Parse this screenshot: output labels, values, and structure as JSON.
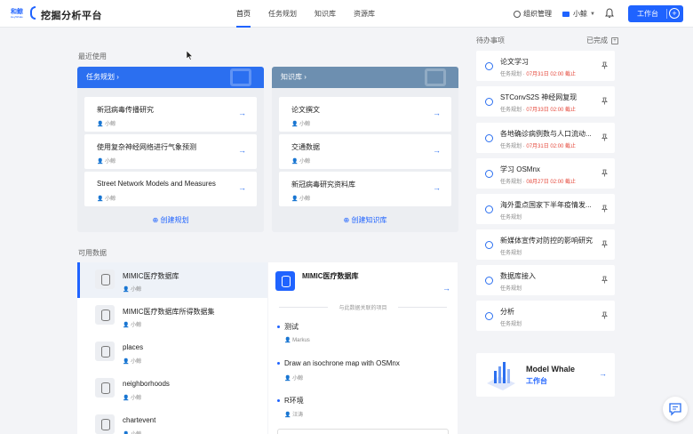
{
  "header": {
    "logo_cn": "和鲸",
    "logo_en": "HeyWhale",
    "app_title": "挖掘分析平台",
    "nav": [
      "首页",
      "任务规划",
      "知识库",
      "资源库"
    ],
    "active_nav": "首页",
    "org": "组织管理",
    "user": "小鲸",
    "workbench": "工作台"
  },
  "recent": {
    "title": "最近使用",
    "planning": {
      "label": "任务规划",
      "items": [
        {
          "title": "新冠病毒传播研究",
          "user": "小鲸"
        },
        {
          "title": "使用复杂神经网络进行气象预测",
          "user": "小鲸"
        },
        {
          "title": "Street Network Models and Measures",
          "user": "小鲸"
        }
      ],
      "create": "创建规划"
    },
    "knowledge": {
      "label": "知识库",
      "items": [
        {
          "title": "论文撰文",
          "user": "小鲸"
        },
        {
          "title": "交通数据",
          "user": "小鲸"
        },
        {
          "title": "新冠病毒研究资料库",
          "user": "小鲸"
        }
      ],
      "create": "创建知识库"
    }
  },
  "data": {
    "title": "可用数据",
    "items": [
      {
        "name": "MIMIC医疗数据库",
        "user": "小鲸"
      },
      {
        "name": "MIMIC医疗数据库所得数据集",
        "user": "小鲸"
      },
      {
        "name": "places",
        "user": "小鲸"
      },
      {
        "name": "neighborhoods",
        "user": "小鲸"
      },
      {
        "name": "chartevent",
        "user": "小鲸"
      }
    ],
    "detail": {
      "name": "MIMIC医疗数据库",
      "related_label": "与此数据关联的项目",
      "projects": [
        {
          "title": "测试",
          "user": "Markus"
        },
        {
          "title": "Draw an isochrone map with OSMnx",
          "user": "小鲸"
        },
        {
          "title": "R环境",
          "user": "汪涛"
        }
      ]
    }
  },
  "todo": {
    "title": "待办事项",
    "done_label": "已完成",
    "items": [
      {
        "name": "论文学习",
        "type": "任务规划",
        "due": "07月31日 02:00 截止"
      },
      {
        "name": "STConvS2S 神经网复现",
        "type": "任务规划",
        "due": "07月33日 02:00 截止"
      },
      {
        "name": "各地确诊病例数与人口流动...",
        "type": "任务规划",
        "due": "07月31日 02:00 截止"
      },
      {
        "name": "学习 OSMnx",
        "type": "任务规划",
        "due": "08月27日 02:00 截止"
      },
      {
        "name": "海外重点国家下半年疫情发...",
        "type": "任务规划",
        "due": ""
      },
      {
        "name": "新媒体宣传对防控的影响研究",
        "type": "任务规划",
        "due": ""
      },
      {
        "name": "数据库接入",
        "type": "任务规划",
        "due": ""
      },
      {
        "name": "分析",
        "type": "任务规划",
        "due": ""
      }
    ]
  },
  "promo": {
    "name": "Model Whale",
    "sub": "工作台"
  },
  "colors": {
    "accent": "#1f63ff",
    "due": "#e5483b",
    "kb_header": "#6d8fb0"
  }
}
